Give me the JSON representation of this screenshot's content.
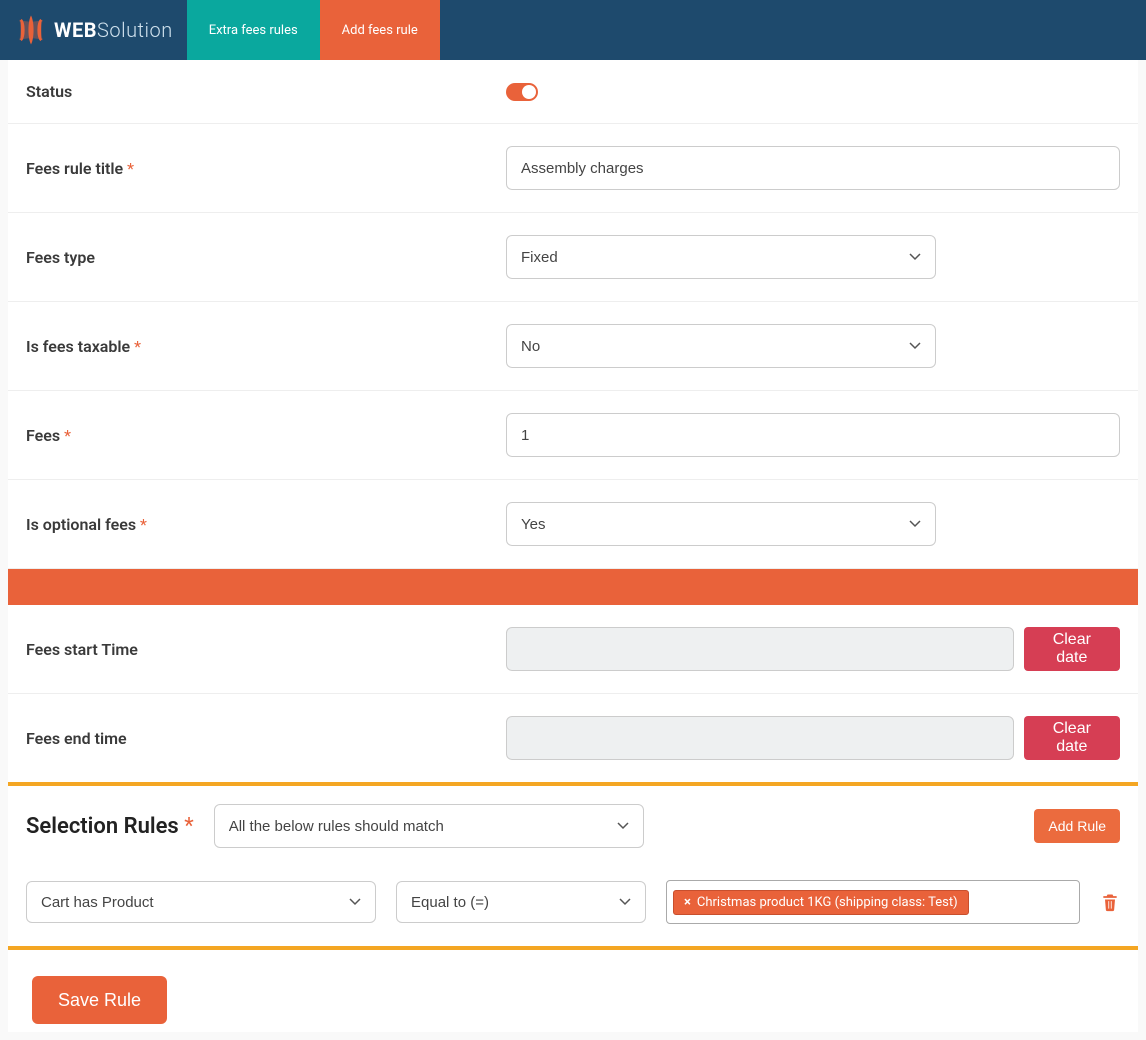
{
  "brand": {
    "name_bold": "WEB",
    "name_light": "Solution"
  },
  "tabs": {
    "extra": "Extra fees rules",
    "add": "Add fees rule"
  },
  "labels": {
    "status": "Status",
    "title": "Fees rule title",
    "type": "Fees type",
    "taxable": "Is fees taxable",
    "fees": "Fees",
    "optional": "Is optional fees",
    "start": "Fees start Time",
    "end": "Fees end time",
    "selection": "Selection Rules"
  },
  "values": {
    "title": "Assembly charges",
    "type": "Fixed",
    "taxable": "No",
    "fees": "1",
    "optional": "Yes",
    "start": "",
    "end": "",
    "match_mode": "All the below rules should match"
  },
  "buttons": {
    "clear_date": "Clear date",
    "add_rule": "Add Rule",
    "save": "Save Rule"
  },
  "rule": {
    "field": "Cart has Product",
    "op": "Equal to (=)",
    "tag": "Christmas product 1KG (shipping class: Test)"
  }
}
